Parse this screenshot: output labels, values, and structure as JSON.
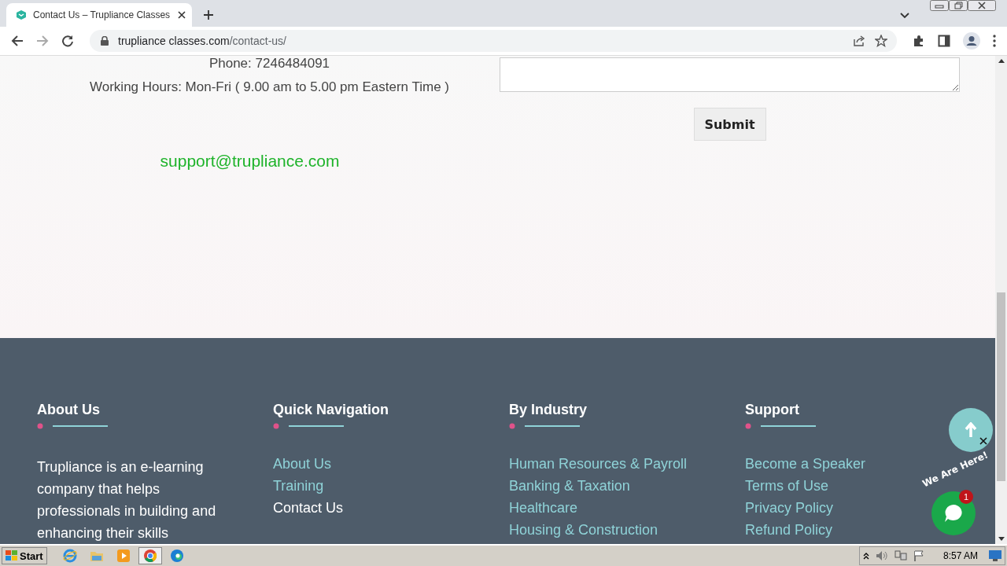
{
  "browser": {
    "tabs": [
      {
        "title": "Contact Us – Trupliance Classes",
        "selected": true
      }
    ],
    "url_host": "trupliance classes.com",
    "url_path": "/contact-us/"
  },
  "contact": {
    "phone": "Phone: 7246484091",
    "hours": "Working Hours: Mon-Fri ( 9.00 am to 5.00 pm Eastern Time )",
    "email": "support@trupliance.com"
  },
  "form": {
    "submit": "Submit"
  },
  "footer": {
    "columns": [
      {
        "heading": "About Us",
        "kind": "text",
        "text": "Trupliance is an e-learning company that helps professionals in building and enhancing their skills"
      },
      {
        "heading": "Quick Navigation",
        "kind": "links",
        "links": [
          {
            "label": "About Us",
            "selected": false
          },
          {
            "label": "Training",
            "selected": false
          },
          {
            "label": "Contact Us",
            "selected": true
          }
        ]
      },
      {
        "heading": "By Industry",
        "kind": "links",
        "links": [
          {
            "label": "Human Resources & Payroll",
            "selected": false
          },
          {
            "label": "Banking & Taxation",
            "selected": false
          },
          {
            "label": "Healthcare",
            "selected": false
          },
          {
            "label": "Housing & Construction",
            "selected": false
          }
        ]
      },
      {
        "heading": "Support",
        "kind": "links",
        "links": [
          {
            "label": "Become a Speaker",
            "selected": false
          },
          {
            "label": "Terms of Use",
            "selected": false
          },
          {
            "label": "Privacy Policy",
            "selected": false
          },
          {
            "label": "Refund Policy",
            "selected": false
          }
        ]
      }
    ]
  },
  "chat_widget": {
    "label": "We Are Here!",
    "badge": "1"
  },
  "taskbar": {
    "start": "Start",
    "clock": "8:57 AM",
    "apps": [
      {
        "kind": "ie",
        "selected": false
      },
      {
        "kind": "folder",
        "selected": false
      },
      {
        "kind": "media",
        "selected": false
      },
      {
        "kind": "chrome",
        "selected": true
      },
      {
        "kind": "edge",
        "selected": false
      }
    ]
  }
}
